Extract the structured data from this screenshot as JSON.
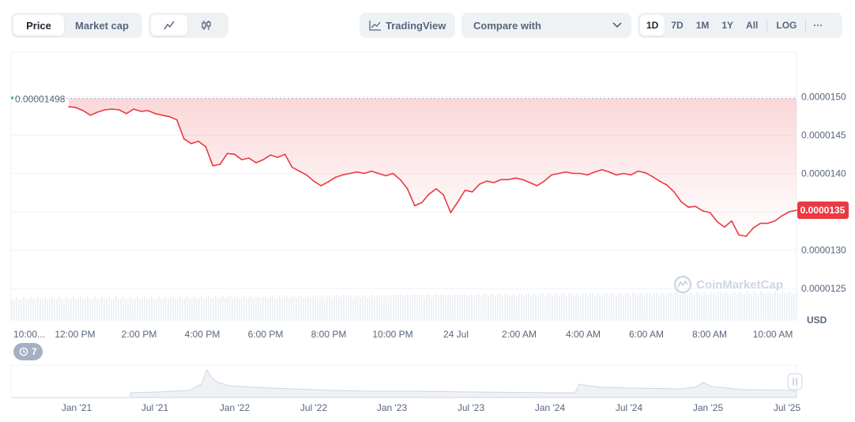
{
  "toolbar": {
    "price_tab": "Price",
    "marketcap_tab": "Market cap",
    "line_icon": "line-chart-icon",
    "candle_icon": "candlestick-icon",
    "tradingview_label": "TradingView",
    "compare_label": "Compare with",
    "ranges": [
      "1D",
      "7D",
      "1M",
      "1Y",
      "All"
    ],
    "log_label": "LOG",
    "more_label": "···"
  },
  "badges": {
    "history_count": "7",
    "watermark": "CoinMarketCap"
  },
  "colors": {
    "line": "#ea3943",
    "grid": "#eff2f5",
    "axis_text": "#58667e",
    "accent": "#16c784"
  },
  "chart_data": {
    "type": "line",
    "currency_label": "USD",
    "open_price_label": "0.00001498",
    "open_price": 1.498e-05,
    "current_price_label": "0.0000135",
    "current_price": 1.352e-05,
    "y_ticks": [
      "0.0000150",
      "0.0000145",
      "0.0000140",
      "0.0000135",
      "0.0000130",
      "0.0000125"
    ],
    "ylim": [
      1.22e-05,
      1.54e-05
    ],
    "x_ticks": [
      "10:00...",
      "12:00 PM",
      "2:00 PM",
      "4:00 PM",
      "6:00 PM",
      "8:00 PM",
      "10:00 PM",
      "24 Jul",
      "2:00 AM",
      "4:00 AM",
      "6:00 AM",
      "8:00 AM",
      "10:00 AM"
    ],
    "series": [
      {
        "values": [
          1.487e-05,
          1.486e-05,
          1.482e-05,
          1.476e-05,
          1.48e-05,
          1.483e-05,
          1.484e-05,
          1.483e-05,
          1.478e-05,
          1.484e-05,
          1.481e-05,
          1.482e-05,
          1.478e-05,
          1.476e-05,
          1.474e-05,
          1.47e-05,
          1.445e-05,
          1.439e-05,
          1.442e-05,
          1.435e-05,
          1.41e-05,
          1.412e-05,
          1.426e-05,
          1.425e-05,
          1.418e-05,
          1.42e-05,
          1.414e-05,
          1.418e-05,
          1.424e-05,
          1.421e-05,
          1.425e-05,
          1.408e-05,
          1.403e-05,
          1.398e-05,
          1.39e-05,
          1.384e-05,
          1.389e-05,
          1.395e-05,
          1.398e-05,
          1.4e-05,
          1.402e-05,
          1.4e-05,
          1.403e-05,
          1.4e-05,
          1.397e-05,
          1.4e-05,
          1.392e-05,
          1.38e-05,
          1.358e-05,
          1.362e-05,
          1.373e-05,
          1.38e-05,
          1.372e-05,
          1.349e-05,
          1.363e-05,
          1.378e-05,
          1.376e-05,
          1.386e-05,
          1.39e-05,
          1.388e-05,
          1.392e-05,
          1.392e-05,
          1.394e-05,
          1.392e-05,
          1.388e-05,
          1.384e-05,
          1.39e-05,
          1.398e-05,
          1.4e-05,
          1.402e-05,
          1.4e-05,
          1.4e-05,
          1.398e-05,
          1.402e-05,
          1.405e-05,
          1.402e-05,
          1.398e-05,
          1.4e-05,
          1.398e-05,
          1.403e-05,
          1.401e-05,
          1.396e-05,
          1.39e-05,
          1.385e-05,
          1.376e-05,
          1.363e-05,
          1.356e-05,
          1.357e-05,
          1.351e-05,
          1.349e-05,
          1.337e-05,
          1.33e-05,
          1.338e-05,
          1.32e-05,
          1.318e-05,
          1.329e-05,
          1.335e-05,
          1.335e-05,
          1.338e-05,
          1.345e-05,
          1.35e-05,
          1.352e-05
        ]
      }
    ]
  },
  "overview": {
    "x_ticks": [
      "Jan '21",
      "Jul '21",
      "Jan '22",
      "Jul '22",
      "Jan '23",
      "Jul '23",
      "Jan '24",
      "Jul '24",
      "Jan '25",
      "Jul '25"
    ]
  }
}
